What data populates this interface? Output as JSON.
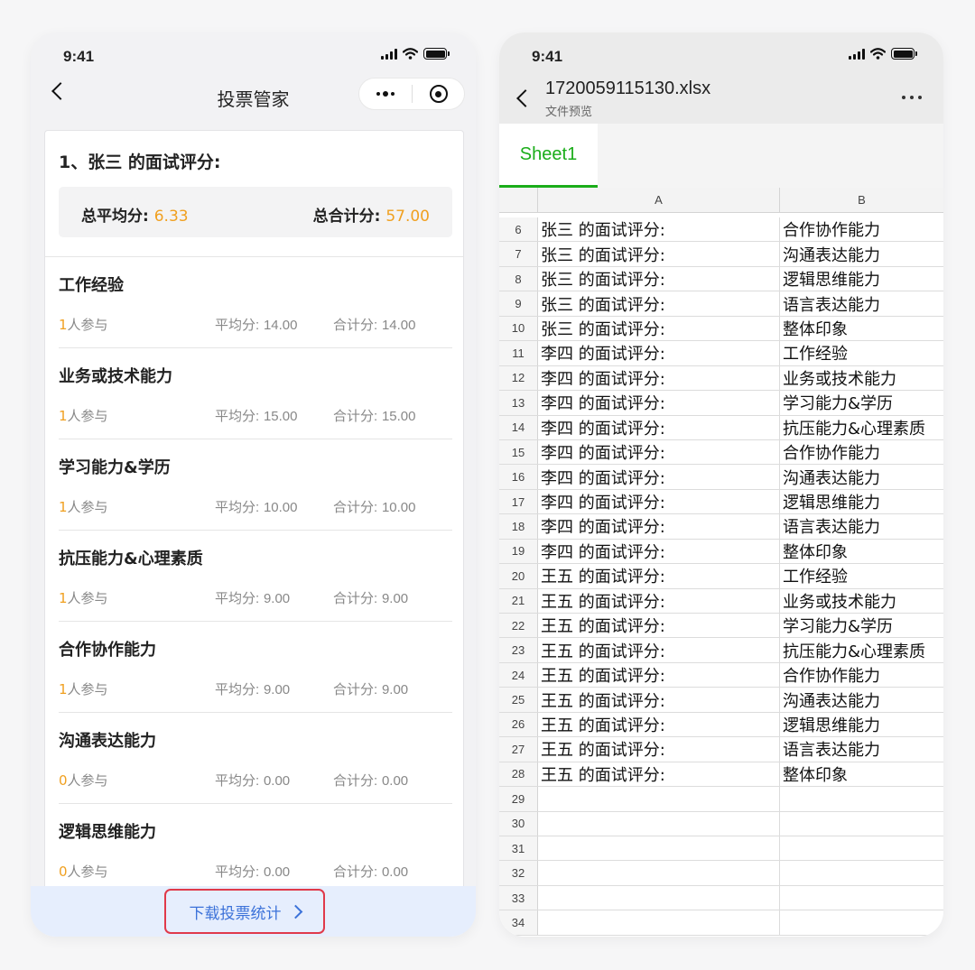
{
  "status": {
    "time": "9:41"
  },
  "left": {
    "nav": {
      "title": "投票管家"
    },
    "question_title": "1、张三 的面试评分:",
    "summary": {
      "avg_label": "总平均分:",
      "avg_value": "6.33",
      "total_label": "总合计分:",
      "total_value": "57.00"
    },
    "items": [
      {
        "name": "工作经验",
        "count": "1",
        "count_suffix": "人参与",
        "avg_label": "平均分:",
        "avg": "14.00",
        "total_label": "合计分:",
        "total": "14.00"
      },
      {
        "name": "业务或技术能力",
        "count": "1",
        "count_suffix": "人参与",
        "avg_label": "平均分:",
        "avg": "15.00",
        "total_label": "合计分:",
        "total": "15.00"
      },
      {
        "name": "学习能力&学历",
        "count": "1",
        "count_suffix": "人参与",
        "avg_label": "平均分:",
        "avg": "10.00",
        "total_label": "合计分:",
        "total": "10.00"
      },
      {
        "name": "抗压能力&心理素质",
        "count": "1",
        "count_suffix": "人参与",
        "avg_label": "平均分:",
        "avg": "9.00",
        "total_label": "合计分:",
        "total": "9.00"
      },
      {
        "name": "合作协作能力",
        "count": "1",
        "count_suffix": "人参与",
        "avg_label": "平均分:",
        "avg": "9.00",
        "total_label": "合计分:",
        "total": "9.00"
      },
      {
        "name": "沟通表达能力",
        "count": "0",
        "count_suffix": "人参与",
        "avg_label": "平均分:",
        "avg": "0.00",
        "total_label": "合计分:",
        "total": "0.00"
      },
      {
        "name": "逻辑思维能力",
        "count": "0",
        "count_suffix": "人参与",
        "avg_label": "平均分:",
        "avg": "0.00",
        "total_label": "合计分:",
        "total": "0.00"
      }
    ],
    "download_button": "下载投票统计"
  },
  "right": {
    "file_title": "1720059115130.xlsx",
    "file_subtitle": "文件预览",
    "sheet_tab": "Sheet1",
    "columns": [
      "A",
      "B"
    ],
    "rows": [
      {
        "n": "6",
        "a": "张三 的面试评分:",
        "b": "合作协作能力"
      },
      {
        "n": "7",
        "a": "张三 的面试评分:",
        "b": "沟通表达能力"
      },
      {
        "n": "8",
        "a": "张三 的面试评分:",
        "b": "逻辑思维能力"
      },
      {
        "n": "9",
        "a": "张三 的面试评分:",
        "b": "语言表达能力"
      },
      {
        "n": "10",
        "a": "张三 的面试评分:",
        "b": "整体印象"
      },
      {
        "n": "11",
        "a": "李四 的面试评分:",
        "b": "工作经验"
      },
      {
        "n": "12",
        "a": "李四 的面试评分:",
        "b": "业务或技术能力"
      },
      {
        "n": "13",
        "a": "李四 的面试评分:",
        "b": "学习能力&学历"
      },
      {
        "n": "14",
        "a": "李四 的面试评分:",
        "b": "抗压能力&心理素质"
      },
      {
        "n": "15",
        "a": "李四 的面试评分:",
        "b": "合作协作能力"
      },
      {
        "n": "16",
        "a": "李四 的面试评分:",
        "b": "沟通表达能力"
      },
      {
        "n": "17",
        "a": "李四 的面试评分:",
        "b": "逻辑思维能力"
      },
      {
        "n": "18",
        "a": "李四 的面试评分:",
        "b": "语言表达能力"
      },
      {
        "n": "19",
        "a": "李四 的面试评分:",
        "b": "整体印象"
      },
      {
        "n": "20",
        "a": "王五 的面试评分:",
        "b": "工作经验"
      },
      {
        "n": "21",
        "a": "王五 的面试评分:",
        "b": "业务或技术能力"
      },
      {
        "n": "22",
        "a": "王五 的面试评分:",
        "b": "学习能力&学历"
      },
      {
        "n": "23",
        "a": "王五 的面试评分:",
        "b": "抗压能力&心理素质"
      },
      {
        "n": "24",
        "a": "王五 的面试评分:",
        "b": "合作协作能力"
      },
      {
        "n": "25",
        "a": "王五 的面试评分:",
        "b": "沟通表达能力"
      },
      {
        "n": "26",
        "a": "王五 的面试评分:",
        "b": "逻辑思维能力"
      },
      {
        "n": "27",
        "a": "王五 的面试评分:",
        "b": "语言表达能力"
      },
      {
        "n": "28",
        "a": "王五 的面试评分:",
        "b": "整体印象"
      },
      {
        "n": "29",
        "a": "",
        "b": ""
      },
      {
        "n": "30",
        "a": "",
        "b": ""
      },
      {
        "n": "31",
        "a": "",
        "b": ""
      },
      {
        "n": "32",
        "a": "",
        "b": ""
      },
      {
        "n": "33",
        "a": "",
        "b": ""
      },
      {
        "n": "34",
        "a": "",
        "b": ""
      }
    ]
  },
  "colors": {
    "accent_orange": "#f0a020",
    "link_blue": "#3c72d9",
    "highlight_red": "#e0394a",
    "tab_green": "#1aad19"
  },
  "icons": [
    "back-chevron-icon",
    "signal-icon",
    "wifi-icon",
    "battery-icon",
    "more-dots-icon",
    "target-icon",
    "chevron-right-icon"
  ]
}
